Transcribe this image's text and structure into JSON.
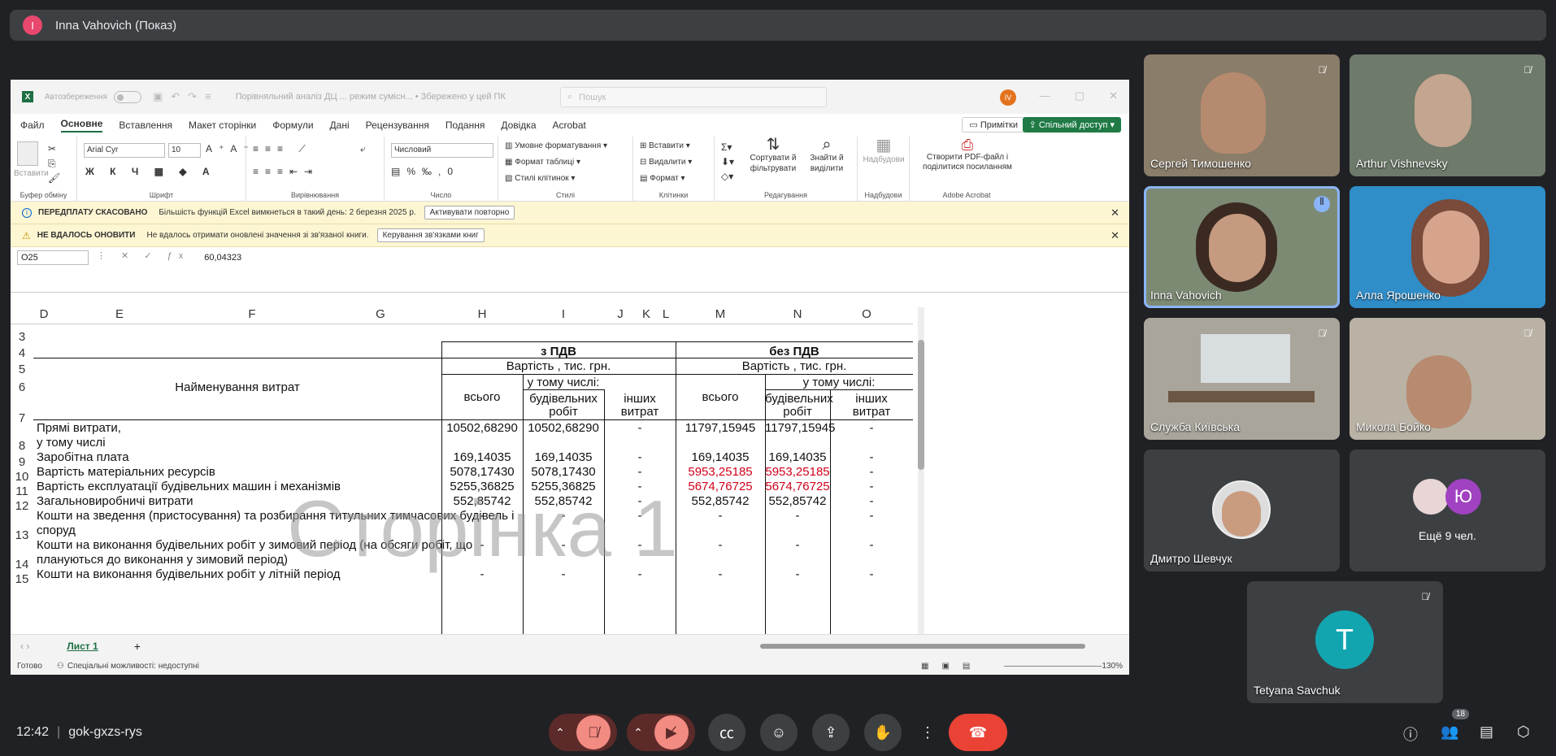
{
  "meet": {
    "presenter_initial": "I",
    "presenter_label": "Inna Vahovich (Показ)",
    "time": "12:42",
    "meeting_code": "gok-gxzs-rys",
    "participants_badge": "18",
    "more_count_label": "Ещё 9 чел.",
    "more_initial": "Ю",
    "tetyana_initial": "T",
    "tiles": [
      {
        "name": "Сергей Тимошенко"
      },
      {
        "name": "Arthur Vishnevsky"
      },
      {
        "name": "Inna Vahovich"
      },
      {
        "name": "Алла Ярошенко"
      },
      {
        "name": "Служба Київська"
      },
      {
        "name": "Микола Бойко"
      },
      {
        "name": "Дмитро Шевчук"
      },
      {
        "name": "Tetyana Savchuk"
      }
    ]
  },
  "excel": {
    "autosave": "Автозбереження",
    "doc_title": "Порівняльний аналіз ДЦ ... режим сумісн... • Збережено у цей ПК",
    "search_placeholder": "Пошук",
    "user_initials": "IV",
    "tabs": [
      "Файл",
      "Основне",
      "Вставлення",
      "Макет сторінки",
      "Формули",
      "Дані",
      "Рецензування",
      "Подання",
      "Довідка",
      "Acrobat"
    ],
    "notes_btn": "Примітки",
    "share_btn": "Спільний доступ",
    "ribbon": {
      "clipboard": "Буфер обміну",
      "paste": "Вставити",
      "font": "Шрифт",
      "font_name": "Arial Cyr",
      "font_size": "10",
      "align": "Вирівнювання",
      "number": "Число",
      "number_format": "Числовий",
      "cond_format": "Умовне форматування",
      "format_table": "Формат таблиці",
      "cell_styles": "Стилі клітинок",
      "styles": "Стилі",
      "insert": "Вставити",
      "delete": "Видалити",
      "format": "Формат",
      "cells": "Клітинки",
      "sort": "Сортувати й фільтрувати",
      "find": "Знайти й виділити",
      "editing": "Редагування",
      "addins": "Надбудови",
      "addins_group": "Надбудови",
      "pdf": "Створити PDF-файл і поділитися посиланням",
      "acrobat": "Adobe Acrobat"
    },
    "msg1": {
      "title": "ПЕРЕДПЛАТУ СКАСОВАНО",
      "text": "Більшість функцій Excel вимкнеться в такий день: 2 березня 2025 р.",
      "button": "Активувати повторно"
    },
    "msg2": {
      "title": "НЕ ВДАЛОСЬ ОНОВИТИ",
      "text": "Не вдалось отримати оновлені значення зі зв'язаної книги.",
      "button": "Керування зв'язками книг"
    },
    "name_box": "O25",
    "formula_value": "60,04323",
    "columns": [
      "D",
      "E",
      "F",
      "G",
      "H",
      "I",
      "J",
      "K",
      "L",
      "M",
      "N",
      "O"
    ],
    "rows": [
      "3",
      "4",
      "5",
      "6",
      "7",
      "8",
      "9",
      "10",
      "11",
      "12",
      "13",
      "14",
      "15"
    ],
    "hdr": {
      "with_vat": "з ПДВ",
      "without_vat": "без ПДВ",
      "cost": "Вартість ,  тис. грн.",
      "cost2": "Вартість ,  тис. грн.",
      "costs_name": "Найменування  витрат",
      "incl": "у тому числі:",
      "incl2": "у тому числі:",
      "total": "всього",
      "total2": "всього",
      "build1": "будівельних",
      "build2": "робіт",
      "other1": "інших",
      "other2": "витрат"
    },
    "table": [
      {
        "name": "Прямі витрати,",
        "h": "10502,68290",
        "i": "10502,68290",
        "j": "-",
        "m": "11797,15945",
        "n": "11797,15945",
        "o": "-"
      },
      {
        "name": "  у тому числі",
        "h": "",
        "i": "",
        "j": "",
        "m": "",
        "n": "",
        "o": ""
      },
      {
        "name": "Заробітна плата",
        "h": "169,14035",
        "i": "169,14035",
        "j": "-",
        "m": "169,14035",
        "n": "169,14035",
        "o": "-"
      },
      {
        "name": "Вартість матеріальних ресурсів",
        "h": "5078,17430",
        "i": "5078,17430",
        "j": "-",
        "m": "5953,25185",
        "n": "5953,25185",
        "o": "-"
      },
      {
        "name": "Вартість експлуатації будівельних машин і механізмів",
        "h": "5255,36825",
        "i": "5255,36825",
        "j": "-",
        "m": "5674,76725",
        "n": "5674,76725",
        "o": "-"
      },
      {
        "name": "Загальновиробничі витрати",
        "h": "552,85742",
        "i": "552,85742",
        "j": "-",
        "m": "552,85742",
        "n": "552,85742",
        "o": "-"
      },
      {
        "name": "Кошти на зведення (пристосування) та розбирання титульних тимчасових будівель і",
        "name2": "споруд",
        "h": "-",
        "i": "-",
        "j": "-",
        "m": "-",
        "n": "-",
        "o": "-"
      },
      {
        "name": "Кошти на виконання будівельних робіт у зимовий період (на обсяги робіт, що",
        "name2": "плануються до виконання у зимовий період)",
        "h": "-",
        "i": "-",
        "j": "-",
        "m": "-",
        "n": "-",
        "o": "-"
      },
      {
        "name": "Кошти на виконання будівельних робіт у літній період",
        "h": "-",
        "i": "-",
        "j": "-",
        "m": "-",
        "n": "-",
        "o": "-"
      }
    ],
    "watermark": "Сторінка 1",
    "sheet_name": "Лист 1",
    "status_ready": "Готово",
    "status_access": "Спеціальні можливості: недоступні",
    "zoom": "130%"
  },
  "colors": {
    "accent": "#1d6f42",
    "red": "#d0021b",
    "end_call": "#ea4335",
    "muted_btn": "#f28b82"
  }
}
